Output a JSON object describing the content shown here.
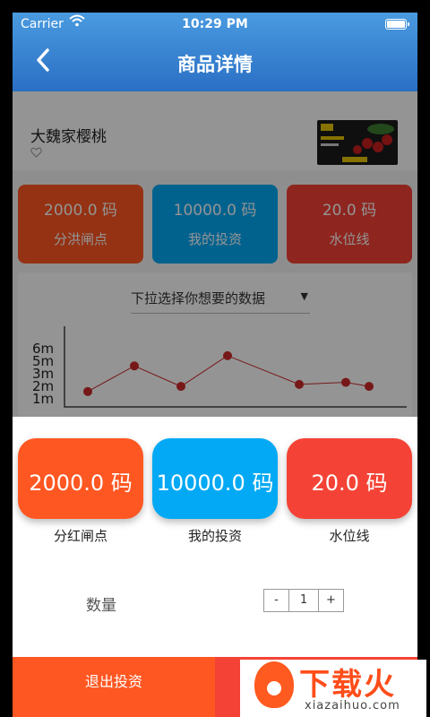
{
  "status_bar": {
    "carrier": "Carrier",
    "time": "10:29 PM"
  },
  "nav": {
    "title": "商品详情"
  },
  "product": {
    "name": "大魏家樱桃"
  },
  "top_cards": [
    {
      "value": "2000.0 码",
      "label": "分洪闸点",
      "color": "#ff5722"
    },
    {
      "value": "10000.0 码",
      "label": "我的投资",
      "color": "#03a9f4"
    },
    {
      "value": "20.0 码",
      "label": "水位线",
      "color": "#f44336"
    }
  ],
  "chart_card": {
    "dropdown_placeholder": "下拉选择你想要的数据"
  },
  "chart_data": {
    "type": "line",
    "y_tick_labels": [
      "6m",
      "5m",
      "3m",
      "2m",
      "1m"
    ],
    "ylim": [
      0,
      7
    ],
    "values": [
      1.5,
      4,
      2,
      5,
      2.2,
      2.4,
      2
    ],
    "line_color": "#cd2a2a"
  },
  "sheet": {
    "cards": [
      {
        "value": "2000.0 码",
        "label": "分红闸点",
        "color": "#ff5722"
      },
      {
        "value": "10000.0 码",
        "label": "我的投资",
        "color": "#03a9f4"
      },
      {
        "value": "20.0 码",
        "label": "水位线",
        "color": "#f44336"
      }
    ],
    "quantity_label": "数量",
    "stepper": {
      "minus": "-",
      "value": "1",
      "plus": "+"
    },
    "exit_label": "退出投资"
  },
  "watermark": {
    "text": "下载火",
    "sub": "xiazaihuo.com"
  },
  "icons": {
    "back": "chevron-left-icon",
    "favorite": "heart-icon",
    "wifi": "wifi-icon",
    "battery": "battery-icon"
  }
}
